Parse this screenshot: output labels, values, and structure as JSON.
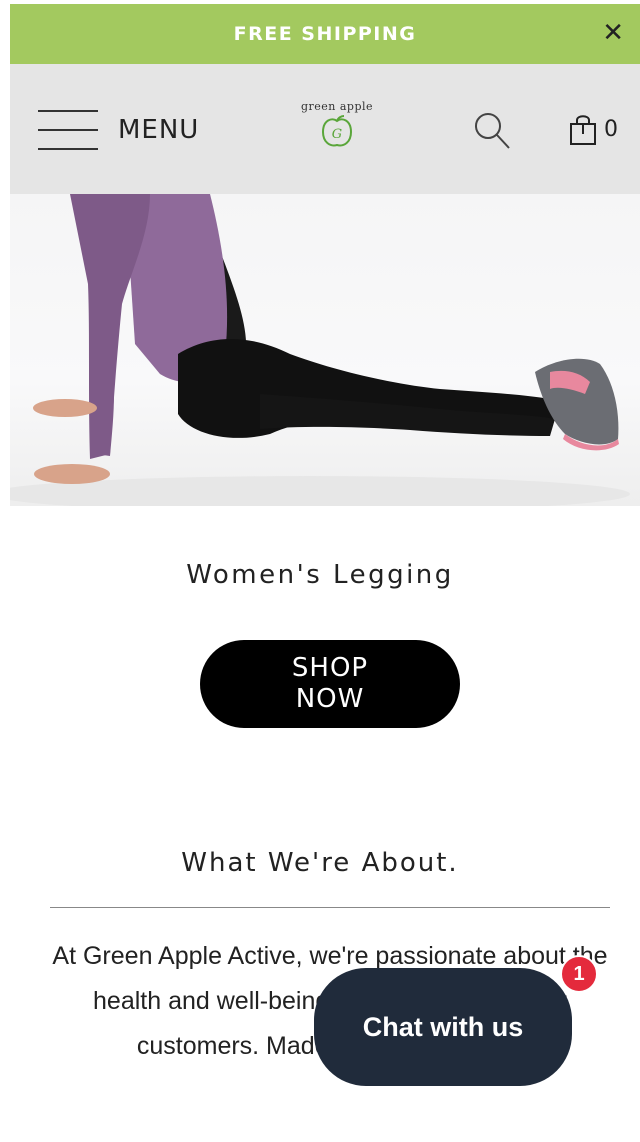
{
  "announcement": {
    "text": "FREE SHIPPING",
    "close_icon": "close-icon"
  },
  "header": {
    "menu_label": "MENU",
    "logo": {
      "name": "green apple",
      "tagline": "",
      "monogram": "GA"
    },
    "search_icon": "search-icon",
    "cart": {
      "icon": "shopping-bag-icon",
      "count": "0"
    }
  },
  "hero": {
    "image_subject": "woman in purple hoodie and black leggings stretching on floor"
  },
  "product": {
    "title": "Women's Legging",
    "shop_label": "SHOP NOW"
  },
  "about": {
    "heading": "What We're About.",
    "body": "At Green Apple Active, we're passionate about the health and well-being of our planet and our customers. Made from the highest-"
  },
  "chat": {
    "label": "Chat with us",
    "badge": "1"
  },
  "colors": {
    "accent": "#a3c95f",
    "header_bg": "#e5e5e5",
    "chat_bg": "#202b3b",
    "badge": "#e42a3c"
  }
}
